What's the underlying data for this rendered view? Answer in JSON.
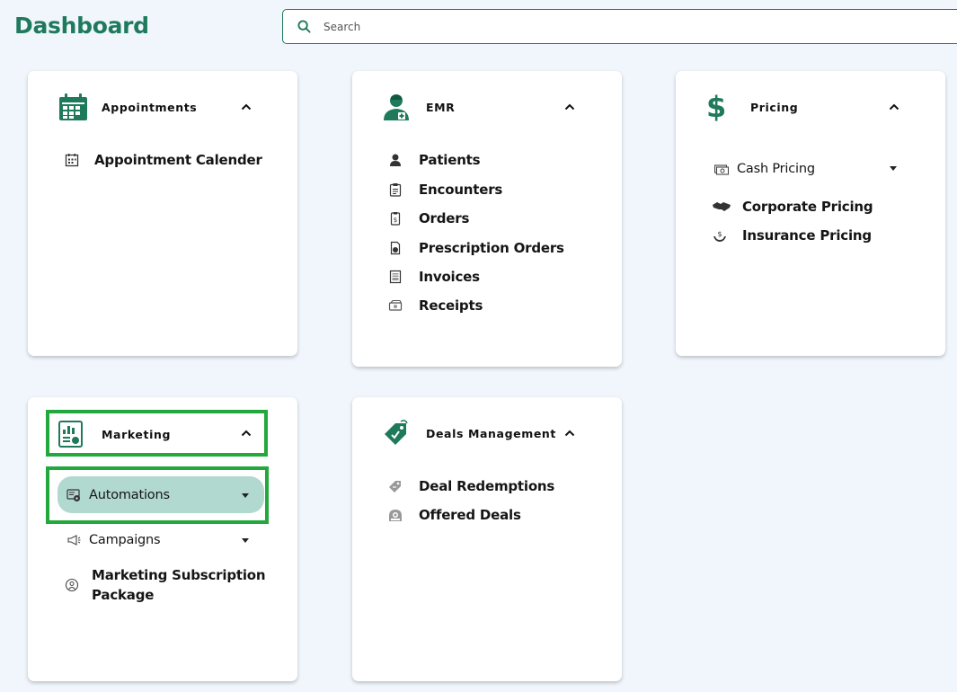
{
  "header": {
    "title": "Dashboard"
  },
  "search": {
    "placeholder": "Search"
  },
  "appointments": {
    "title": "Appointments",
    "items": [
      {
        "label": "Appointment Calender",
        "icon": "calendar-icon"
      }
    ]
  },
  "emr": {
    "title": "EMR",
    "items": [
      {
        "label": "Patients",
        "icon": "patient-icon"
      },
      {
        "label": "Encounters",
        "icon": "clipboard-icon"
      },
      {
        "label": "Orders",
        "icon": "order-icon"
      },
      {
        "label": "Prescription Orders",
        "icon": "prescription-icon"
      },
      {
        "label": "Invoices",
        "icon": "invoice-icon"
      },
      {
        "label": "Receipts",
        "icon": "receipt-icon"
      }
    ]
  },
  "pricing": {
    "title": "Pricing",
    "cash": {
      "label": "Cash Pricing",
      "icon": "cash-icon"
    },
    "items": [
      {
        "label": "Corporate Pricing",
        "icon": "handshake-icon"
      },
      {
        "label": "Insurance Pricing",
        "icon": "insurance-icon"
      }
    ]
  },
  "marketing": {
    "title": "Marketing",
    "automations": {
      "label": "Automations",
      "icon": "automation-icon"
    },
    "campaigns": {
      "label": "Campaigns",
      "icon": "megaphone-icon"
    },
    "subscription": {
      "label_line1": "Marketing Subscription",
      "label_line2": "Package",
      "icon": "subscription-icon"
    }
  },
  "deals": {
    "title": "Deals Management",
    "items": [
      {
        "label": "Deal Redemptions",
        "icon": "tag-icon"
      },
      {
        "label": "Offered Deals",
        "icon": "deal-icon"
      }
    ]
  },
  "colors": {
    "brand": "#1f7a5c",
    "highlight": "#22a83c",
    "active_pill": "#b1d9d0"
  }
}
